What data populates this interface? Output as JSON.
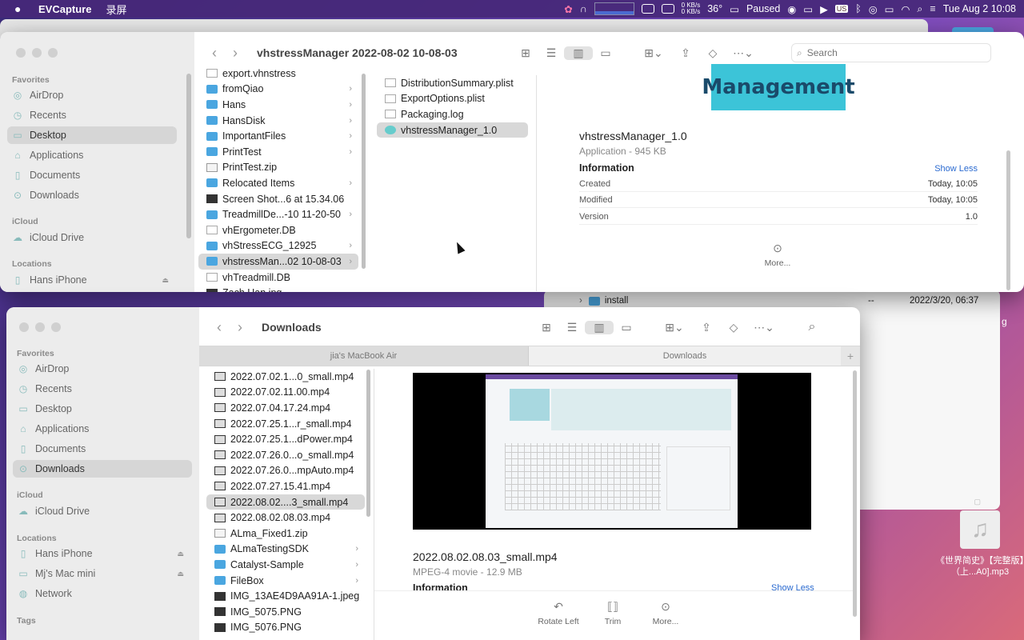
{
  "menubar": {
    "app": "EVCapture",
    "menu1": "录屏",
    "net_up": "0 KB/s",
    "net_down": "0 KB/s",
    "temp": "36°",
    "paused": "Paused",
    "datetime": "Tue Aug 2  10:08"
  },
  "bg_finder": {
    "row_name": "install",
    "row_kind": "--",
    "row_date": "2022/3/20, 06:37"
  },
  "desktop_file": {
    "label": "《世界简史》【完整版】（上...A0].mp3"
  },
  "top_window": {
    "title": "vhstressManager 2022-08-02 10-08-03",
    "search_placeholder": "Search",
    "sidebar": {
      "favorites_label": "Favorites",
      "favorites": [
        "AirDrop",
        "Recents",
        "Desktop",
        "Applications",
        "Documents",
        "Downloads"
      ],
      "icloud_label": "iCloud",
      "icloud": [
        "iCloud Drive"
      ],
      "locations_label": "Locations",
      "locations": [
        "Hans iPhone"
      ]
    },
    "col1": [
      {
        "name": "export.vhnstress",
        "type": "doc"
      },
      {
        "name": "fromQiao",
        "type": "folder"
      },
      {
        "name": "Hans",
        "type": "folder"
      },
      {
        "name": "HansDisk",
        "type": "folder"
      },
      {
        "name": "ImportantFiles",
        "type": "folder"
      },
      {
        "name": "PrintTest",
        "type": "folder"
      },
      {
        "name": "PrintTest.zip",
        "type": "zip"
      },
      {
        "name": "Relocated Items",
        "type": "folder"
      },
      {
        "name": "Screen Shot...6 at 15.34.06",
        "type": "img"
      },
      {
        "name": "TreadmillDe...-10 11-20-50",
        "type": "folder"
      },
      {
        "name": "vhErgometer.DB",
        "type": "doc"
      },
      {
        "name": "vhStressECG_12925",
        "type": "folder"
      },
      {
        "name": "vhstressMan...02 10-08-03",
        "type": "folder"
      },
      {
        "name": "vhTreadmill.DB",
        "type": "doc"
      },
      {
        "name": "Zach Han.jpg",
        "type": "img"
      }
    ],
    "col2": [
      "DistributionSummary.plist",
      "ExportOptions.plist",
      "Packaging.log",
      "vhstressManager_1.0"
    ],
    "preview": {
      "banner": "Management",
      "name": "vhstressManager_1.0",
      "kind": "Application - 945 KB",
      "info_label": "Information",
      "show_less": "Show Less",
      "created_k": "Created",
      "created_v": "Today, 10:05",
      "modified_k": "Modified",
      "modified_v": "Today, 10:05",
      "version_k": "Version",
      "version_v": "1.0",
      "more": "More..."
    }
  },
  "bottom_window": {
    "title": "Downloads",
    "tabs": [
      "jia's MacBook Air",
      "Downloads"
    ],
    "sidebar": {
      "favorites_label": "Favorites",
      "favorites": [
        "AirDrop",
        "Recents",
        "Desktop",
        "Applications",
        "Documents",
        "Downloads"
      ],
      "icloud_label": "iCloud",
      "icloud": [
        "iCloud Drive"
      ],
      "locations_label": "Locations",
      "locations": [
        "Hans iPhone",
        "Mj's Mac mini",
        "Network"
      ],
      "tags_label": "Tags"
    },
    "files": [
      {
        "name": "2022.07.02.1...0_small.mp4",
        "type": "vid"
      },
      {
        "name": "2022.07.02.11.00.mp4",
        "type": "vid"
      },
      {
        "name": "2022.07.04.17.24.mp4",
        "type": "vid"
      },
      {
        "name": "2022.07.25.1...r_small.mp4",
        "type": "vid"
      },
      {
        "name": "2022.07.25.1...dPower.mp4",
        "type": "vid"
      },
      {
        "name": "2022.07.26.0...o_small.mp4",
        "type": "vid"
      },
      {
        "name": "2022.07.26.0...mpAuto.mp4",
        "type": "vid"
      },
      {
        "name": "2022.07.27.15.41.mp4",
        "type": "vid"
      },
      {
        "name": "2022.08.02....3_small.mp4",
        "type": "vid"
      },
      {
        "name": "2022.08.02.08.03.mp4",
        "type": "vid"
      },
      {
        "name": "ALma_Fixed1.zip",
        "type": "zip"
      },
      {
        "name": "ALmaTestingSDK",
        "type": "folder"
      },
      {
        "name": "Catalyst-Sample",
        "type": "folder"
      },
      {
        "name": "FileBox",
        "type": "folder"
      },
      {
        "name": "IMG_13AE4D9AA91A-1.jpeg",
        "type": "img"
      },
      {
        "name": "IMG_5075.PNG",
        "type": "img"
      },
      {
        "name": "IMG_5076.PNG",
        "type": "img"
      }
    ],
    "preview": {
      "name": "2022.08.02.08.03_small.mp4",
      "kind": "MPEG-4 movie - 12.9 MB",
      "info_label": "Information",
      "show_less": "Show Less",
      "rotate": "Rotate Left",
      "trim": "Trim",
      "more": "More..."
    }
  }
}
